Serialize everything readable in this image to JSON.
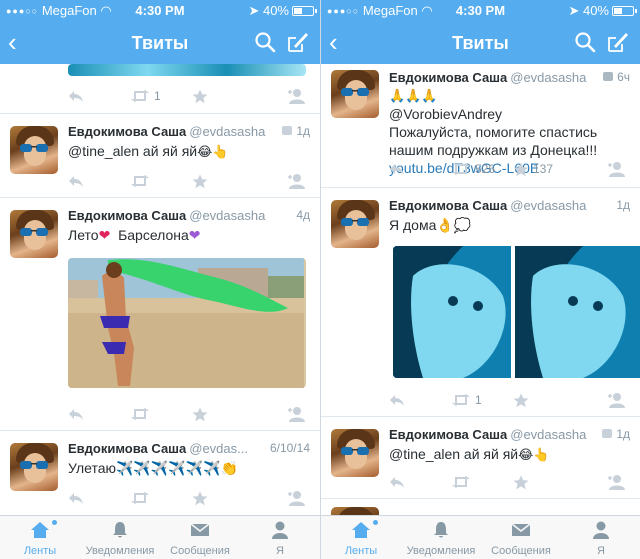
{
  "colors": {
    "accent": "#55acee",
    "link": "#2b7bb9",
    "name": "#292f33",
    "muted": "#8899a6",
    "heart": "#e0245e",
    "purple": "#9b59d6"
  },
  "statusbar": {
    "carrier": "MegaFon",
    "time": "4:30 PM",
    "battery": "40%"
  },
  "navbar": {
    "title": "Твиты"
  },
  "tabbar": {
    "tabs": [
      {
        "label": "Ленты",
        "active": true
      },
      {
        "label": "Уведомления"
      },
      {
        "label": "Сообщения"
      },
      {
        "label": "Я"
      }
    ]
  },
  "left": {
    "partial": {
      "retweet_count": "1"
    },
    "tweets": [
      {
        "name": "Евдокимова Саша",
        "handle": "@evdasasha",
        "time": "1д",
        "text": "@tine_alen ай яй яй",
        "emoji": "😂👆"
      },
      {
        "name": "Евдокимова Саша",
        "handle": "@evdasasha",
        "time": "4д",
        "text": "Лето",
        "text2": "Барселона"
      },
      {
        "name": "Евдокимова Саша",
        "handle": "@evdas...",
        "time": "6/10/14",
        "text": "Улетаю✈️✈️✈️✈️✈️✈️👏"
      }
    ]
  },
  "right": {
    "tweets": [
      {
        "name": "Евдокимова Саша",
        "handle": "@evdasasha",
        "time": "6ч",
        "emoji_line": "🙏🙏🙏",
        "text": "@VorobievAndrey",
        "text2": "Пожалуйста, помогите спастись нашим подружкам из Донецка!!!",
        "link": "youtu.be/dT3wGC-L60E",
        "retweets": "526",
        "favorites": "137"
      },
      {
        "name": "Евдокимова Саша",
        "handle": "@evdasasha",
        "time": "1д",
        "text": "Я дома👌💭",
        "retweet_count": "1"
      },
      {
        "name": "Евдокимова Саша",
        "handle": "@evdasasha",
        "time": "1д",
        "text": "@tine_alen ай яй яй",
        "emoji": "😂👆"
      }
    ]
  }
}
